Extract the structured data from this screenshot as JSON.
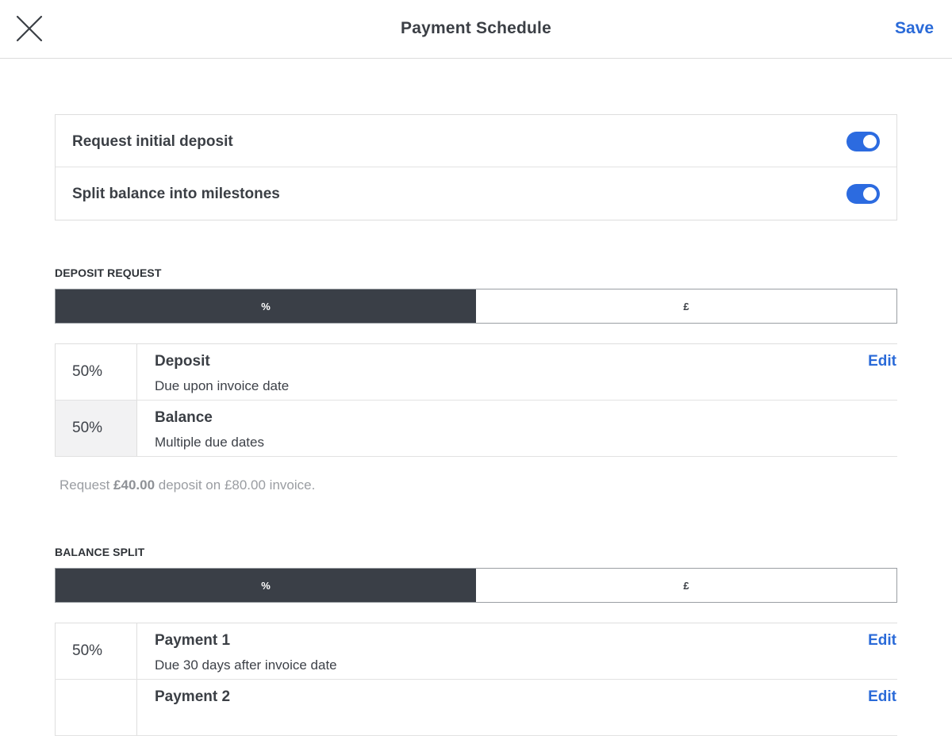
{
  "header": {
    "title": "Payment Schedule",
    "save_label": "Save"
  },
  "toggles": [
    {
      "label": "Request initial deposit",
      "on": true
    },
    {
      "label": "Split balance into milestones",
      "on": true
    }
  ],
  "deposit": {
    "section_label": "DEPOSIT REQUEST",
    "mode_options": [
      "%",
      "£"
    ],
    "selected_mode": "%",
    "rows": [
      {
        "percent": "50%",
        "title": "Deposit",
        "subtitle": "Due upon invoice date",
        "edit_label": "Edit"
      },
      {
        "percent": "50%",
        "title": "Balance",
        "subtitle": "Multiple due dates"
      }
    ],
    "note": {
      "prefix": "Request ",
      "amount": "£40.00",
      "suffix": " deposit on £80.00 invoice."
    }
  },
  "balance": {
    "section_label": "BALANCE SPLIT",
    "mode_options": [
      "%",
      "£"
    ],
    "selected_mode": "%",
    "rows": [
      {
        "percent": "50%",
        "title": "Payment 1",
        "subtitle": "Due 30 days after invoice date",
        "edit_label": "Edit"
      },
      {
        "percent": "",
        "title": "Payment 2",
        "subtitle": "",
        "edit_label": "Edit"
      }
    ]
  },
  "colors": {
    "accent": "#2a6ad8",
    "toggle_on": "#2c6be0",
    "segment_active": "#3a3f47"
  }
}
